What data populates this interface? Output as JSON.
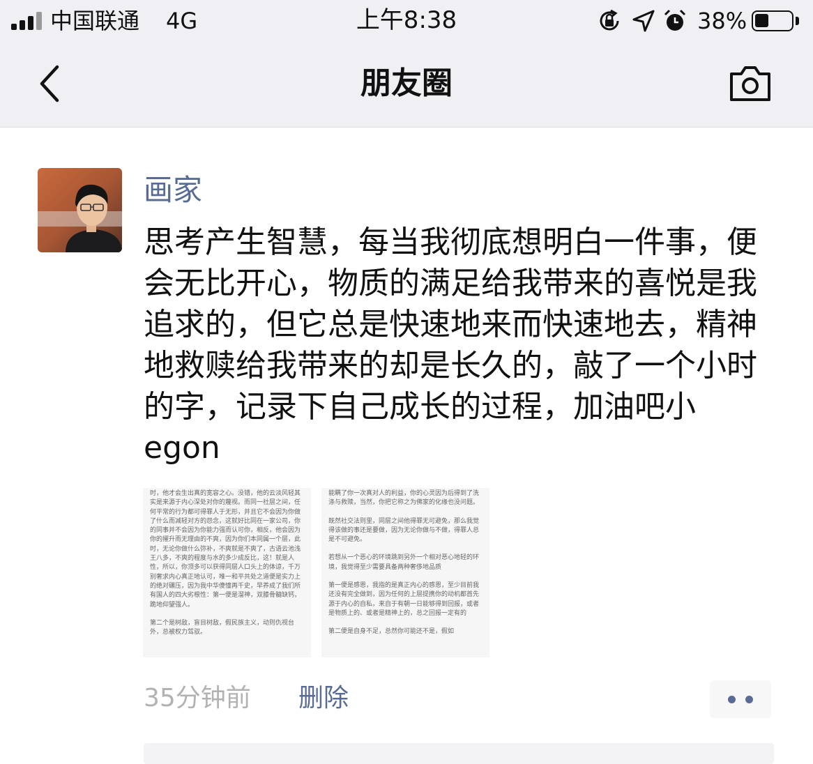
{
  "status_bar": {
    "carrier": "中国联通",
    "network": "4G",
    "time": "上午8:38",
    "battery_percent_text": "38%",
    "battery_level": 0.38,
    "icons": [
      "signal-icon",
      "rotation-lock-icon",
      "location-icon",
      "alarm-icon",
      "battery-icon"
    ]
  },
  "nav": {
    "title": "朋友圈",
    "back_icon": "chevron-left-icon",
    "camera_icon": "camera-icon"
  },
  "post": {
    "author": "画家",
    "text": "思考产生智慧，每当我彻底想明白一件事，便会无比开心，物质的满足给我带来的喜悦是我追求的，但它总是快速地来而快速地去，精神地救赎给我带来的却是长久的，敲了一个小时的字，记录下自己成长的过程，加油吧小egon",
    "images": [
      {
        "paragraphs": [
          "时，他才会生出真的宽容之心。没错，他的云淡风轻其实是来源于内心深处对你的蔑视。而同一社层之间，任何平常的行为都可得罪人于无形，并且它不会因为你做了什么而减轻对方的怨念，这就好比同在一家公司，你的同事并不会因为你能力强而认可你，相反，他会因为你的擢升而无理由的不爽，因为你们本同属一个层，此时，无论你做什么弥补，不爽就是不爽了，古语云池浅王八多，不爽的程度与水的多少成反比，这！就是人性，所以，你顶多可以获得同层人口头上的体谅，千万别奢求内心真正地认可，唯一和平共处之道便是实力上的绝对碾压，因为我中华傻憧再千史，早养成了我们所有国人的四大劣根性：第一便是溜神，双膝骨髓缺钙，跪地仰望强人。",
          "第二个是树敌，盲目树敌，假民族主义，动则仇视台外，总被权力驾驭。"
        ]
      },
      {
        "paragraphs": [
          "能瞒了你一次真对人的利益，你的心灵因为后得到了洗涤与救赎，当然，你把它称之为佛家的化缘也没问题。",
          "既然社交法则里，同层之间他得罪无可避免，那么我觉得该做的事还是要做，因为无论你做与不做，得罪人总是不可避免。",
          "若想从一个恶心的环境跳到另外一个相对恶心地轻的环境，我觉得至少需要具备两种奢侈地品质",
          "第一便是感恩，我指的是真正内心的感恩，至少目前我还没有完全做到，因为任何的上层提携你的动机都首先源于内心的自私，来自于有朝一日能够得到回报，或者是物质上的、或者是精神上的，总之回报一定有的",
          "第二便是自身不足，总然你可能还不是，假如"
        ]
      }
    ],
    "time_ago": "35分钟前",
    "delete_label": "删除",
    "more_icon": "more-dots-icon"
  },
  "colors": {
    "link_blue": "#576b95",
    "nav_background": "#efeff4",
    "muted_text": "#b2b2b2"
  }
}
